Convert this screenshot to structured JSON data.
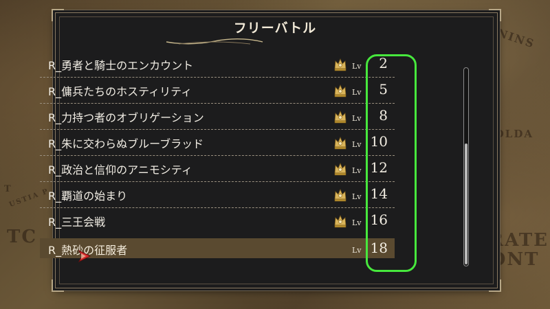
{
  "map": {
    "labels": {
      "peninsula": "PENINS",
      "solda": "SOLDA",
      "fratia_line1": "FRATE",
      "fratia_line2": "CONT",
      "tc": "TC",
      "ustia": "USTIA P",
      "t1": "T"
    }
  },
  "panel": {
    "title": "フリーバトル"
  },
  "battles": [
    {
      "name": "R_勇者と騎士のエンカウント",
      "lv_prefix": "Lv",
      "level": "2",
      "cleared": true
    },
    {
      "name": "R_傭兵たちのホスティリティ",
      "lv_prefix": "Lv",
      "level": "5",
      "cleared": true
    },
    {
      "name": "R_力持つ者のオブリゲーション",
      "lv_prefix": "Lv",
      "level": "8",
      "cleared": true
    },
    {
      "name": "R_朱に交わらぬブルーブラッド",
      "lv_prefix": "Lv",
      "level": "10",
      "cleared": true
    },
    {
      "name": "R_政治と信仰のアニモシティ",
      "lv_prefix": "Lv",
      "level": "12",
      "cleared": true
    },
    {
      "name": "R_覇道の始まり",
      "lv_prefix": "Lv",
      "level": "14",
      "cleared": true
    },
    {
      "name": "R_三王会戦",
      "lv_prefix": "Lv",
      "level": "16",
      "cleared": true
    },
    {
      "name": "R_熱砂の征服者",
      "lv_prefix": "Lv",
      "level": "18",
      "cleared": false,
      "selected": true
    }
  ],
  "colors": {
    "highlight": "#47e83d",
    "selected_row": "#5a4a30",
    "cursor": "#d42a2a",
    "crown_gold": "#d9b45a"
  },
  "icons": {
    "cleared": "crown-icon",
    "cursor": "cursor-arrow-icon"
  },
  "scroll": {
    "visible_fraction": 0.62,
    "position": "bottom"
  }
}
